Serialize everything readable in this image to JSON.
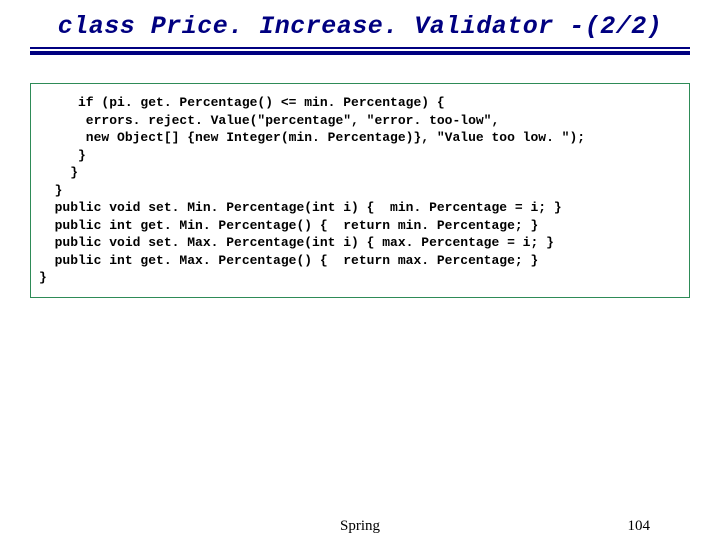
{
  "title": "class Price. Increase. Validator -(2/2)",
  "code": "     if (pi. get. Percentage() <= min. Percentage) {\n      errors. reject. Value(\"percentage\", \"error. too-low\",\n      new Object[] {new Integer(min. Percentage)}, \"Value too low. \");\n     }\n    }\n  }\n  public void set. Min. Percentage(int i) {  min. Percentage = i; }\n  public int get. Min. Percentage() {  return min. Percentage; }\n  public void set. Max. Percentage(int i) { max. Percentage = i; }\n  public int get. Max. Percentage() {  return max. Percentage; }\n}",
  "footer": {
    "center": "Spring",
    "pageNumber": "104"
  }
}
